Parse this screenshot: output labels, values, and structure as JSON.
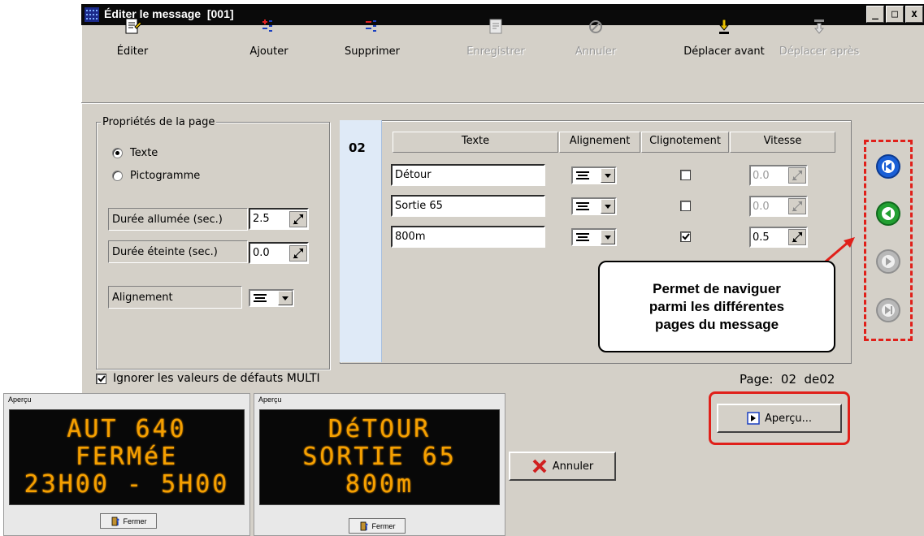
{
  "window": {
    "title": "Éditer le message  [001]",
    "buttons": [
      "_",
      "□",
      "x"
    ]
  },
  "toolbar": {
    "items": [
      {
        "label": "Éditer",
        "icon": "edit-icon",
        "enabled": true
      },
      {
        "label": "Ajouter",
        "icon": "add-icon",
        "enabled": true
      },
      {
        "label": "Supprimer",
        "icon": "delete-icon",
        "enabled": true
      },
      {
        "label": "Enregistrer",
        "icon": "save-icon",
        "enabled": false
      },
      {
        "label": "Annuler",
        "icon": "undo-icon",
        "enabled": false
      },
      {
        "label": "Déplacer avant",
        "icon": "move-before-icon",
        "enabled": true
      },
      {
        "label": "Déplacer après",
        "icon": "move-after-icon",
        "enabled": false
      }
    ]
  },
  "page_props": {
    "title": "Propriétés de la page",
    "radio_text": "Texte",
    "radio_picto": "Pictogramme",
    "on_label": "Durée allumée (sec.)",
    "on_value": "2.5",
    "off_label": "Durée éteinte (sec.)",
    "off_value": "0.0",
    "align_label": "Alignement"
  },
  "page_number": "02",
  "columns": {
    "text": "Texte",
    "align": "Alignement",
    "blink": "Clignotement",
    "speed": "Vitesse"
  },
  "lines": [
    {
      "text": "Détour",
      "blink": false,
      "speed": "0.0",
      "speed_enabled": false
    },
    {
      "text": "Sortie 65",
      "blink": false,
      "speed": "0.0",
      "speed_enabled": false
    },
    {
      "text": "800m",
      "blink": true,
      "speed": "0.5",
      "speed_enabled": true
    }
  ],
  "callout": {
    "line1": "Permet de naviguer",
    "line2": "parmi les différentes",
    "line3": "pages du message"
  },
  "ignore_label": "Ignorer les valeurs de défauts MULTI",
  "page_info": "Page:  02  de02",
  "apercu_label": "Aperçu...",
  "annuler_label": "Annuler",
  "previews": [
    {
      "title": "Aperçu",
      "lines": [
        "AUT 640",
        "FERMéE",
        "23H00 - 5H00"
      ],
      "button": "Fermer"
    },
    {
      "title": "Aperçu",
      "lines": [
        "DéTOUR",
        "SORTIE 65",
        "800m"
      ],
      "button": "Fermer"
    }
  ],
  "colors": {
    "accent_red": "#e0201a",
    "led_amber": "#f5a000",
    "nav_blue": "#1a5fd6",
    "nav_green": "#22a032"
  }
}
